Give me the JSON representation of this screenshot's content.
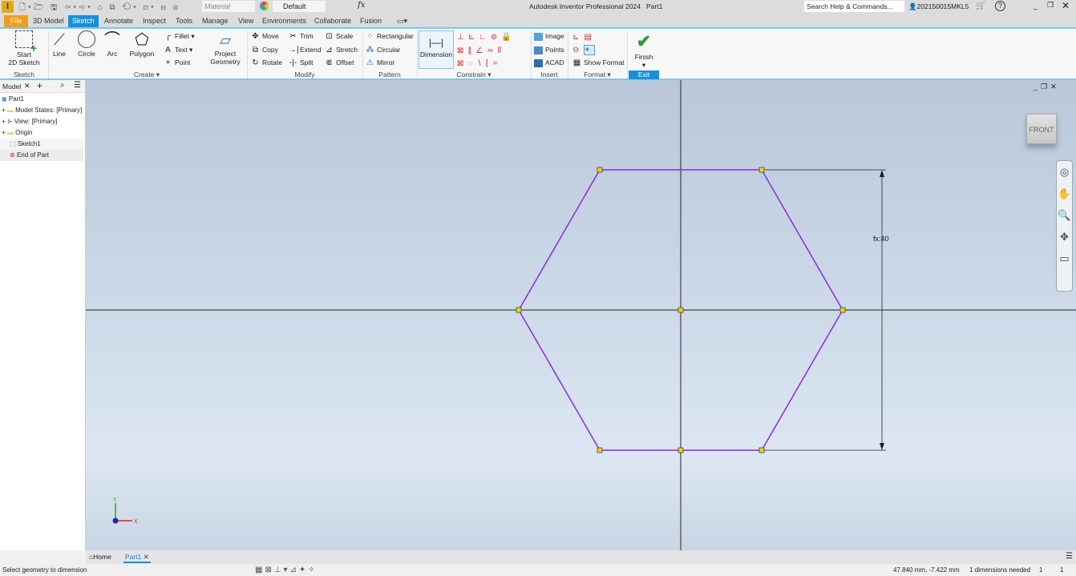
{
  "app": {
    "title": "Autodesk Inventor Professional 2024",
    "document": "Part1",
    "search_placeholder": "Search Help & Commands...",
    "user": "202150015MKL5",
    "material": "Material",
    "appearance": "Default"
  },
  "tabs": [
    "File",
    "3D Model",
    "Sketch",
    "Annotate",
    "Inspect",
    "Tools",
    "Manage",
    "View",
    "Environments",
    "Collaborate",
    "Fusion"
  ],
  "ribbon": {
    "sketch": {
      "label": "Sketch",
      "start": "Start",
      "start2": "2D Sketch"
    },
    "create": {
      "label": "Create",
      "line": "Line",
      "circle": "Circle",
      "arc": "Arc",
      "polygon": "Polygon",
      "fillet": "Fillet",
      "text": "Text",
      "point": "Point",
      "project": "Project",
      "project2": "Geometry"
    },
    "modify": {
      "label": "Modify",
      "move": "Move",
      "trim": "Trim",
      "scale": "Scale",
      "copy": "Copy",
      "extend": "Extend",
      "stretch": "Stretch",
      "rotate": "Rotate",
      "split": "Split",
      "offset": "Offset"
    },
    "pattern": {
      "label": "Pattern",
      "rectangular": "Rectangular",
      "circular": "Circular",
      "mirror": "Mirror"
    },
    "constrain": {
      "label": "Constrain",
      "dimension": "Dimension"
    },
    "insert": {
      "label": "Insert",
      "image": "Image",
      "points": "Points",
      "acad": "ACAD"
    },
    "format": {
      "label": "Format",
      "show_format": "Show Format"
    },
    "exit": {
      "label": "Exit",
      "finish": "Finish"
    }
  },
  "browser": {
    "tab": "Model",
    "items": [
      {
        "label": "Part1",
        "icon": "part-icon"
      },
      {
        "label": "Model States: [Primary]",
        "icon": "folder-icon"
      },
      {
        "label": "View: [Primary]",
        "icon": "view-icon"
      },
      {
        "label": "Origin",
        "icon": "folder-icon"
      },
      {
        "label": "Sketch1",
        "icon": "sketch-icon"
      },
      {
        "label": "End of Part",
        "icon": "end-of-part-icon"
      }
    ]
  },
  "viewcube": {
    "face": "FRONT"
  },
  "sketch": {
    "dimension_label": "fx:40",
    "line_color": "#8a2be2",
    "point_color": "#f2d21b"
  },
  "triad": {
    "x": "X",
    "y": "Y"
  },
  "doc_tabs": {
    "home": "Home",
    "part": "Part1"
  },
  "status": {
    "prompt": "Select geometry to dimension",
    "coords": "47.840 mm, -7.422 mm",
    "dims_needed": "1 dimensions needed",
    "n1": "1",
    "n2": "1"
  }
}
